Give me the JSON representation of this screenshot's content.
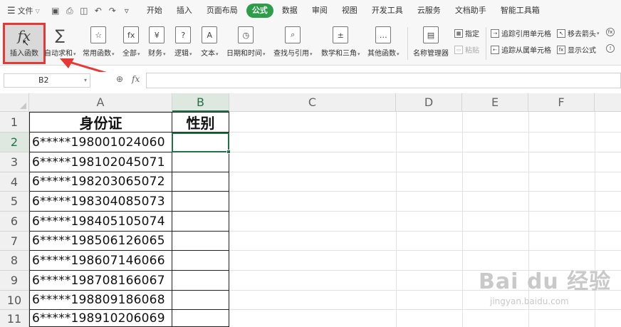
{
  "menubar": {
    "file_label": "文件",
    "tabs": [
      {
        "label": "开始"
      },
      {
        "label": "插入"
      },
      {
        "label": "页面布局"
      },
      {
        "label": "公式",
        "active": true
      },
      {
        "label": "数据"
      },
      {
        "label": "审阅"
      },
      {
        "label": "视图"
      },
      {
        "label": "开发工具"
      },
      {
        "label": "云服务"
      },
      {
        "label": "文档助手"
      },
      {
        "label": "智能工具箱"
      }
    ]
  },
  "ribbon": {
    "insert_function": "插入函数",
    "autosum": "自动求和",
    "common": "常用函数",
    "all": "全部",
    "finance": "财务",
    "logic": "逻辑",
    "text": "文本",
    "datetime": "日期和时间",
    "lookup": "查找与引用",
    "math": "数学和三角",
    "other": "其他函数",
    "name_manager": "名称管理器",
    "assign": "指定",
    "paste": "粘贴",
    "trace_precedents": "追踪引用单元格",
    "trace_dependents": "追踪从属单元格",
    "remove_arrows": "移去箭头",
    "show_formulas": "显示公式"
  },
  "formula_bar": {
    "name_box": "B2",
    "fx": "fx",
    "value": ""
  },
  "grid": {
    "columns": [
      "A",
      "B",
      "C",
      "D",
      "E",
      "F"
    ],
    "rows": [
      "1",
      "2",
      "3",
      "4",
      "5",
      "6",
      "7",
      "8",
      "9",
      "10",
      "11"
    ],
    "header_a": "身份证",
    "header_b": "性别",
    "ids": [
      "6*****198001024060",
      "6*****198102045071",
      "6*****198203065072",
      "6*****198304085073",
      "6*****198405105074",
      "6*****198506126065",
      "6*****198607146066",
      "6*****198708166067",
      "6*****198809186068",
      "6*****198910206069"
    ],
    "selected_cell": "B2"
  },
  "watermark": {
    "brand": "Bai du 经验",
    "url": "jingyan.baidu.com"
  },
  "colors": {
    "active_tab": "#2e9d49",
    "selection": "#217346",
    "highlight_box": "#e53935"
  }
}
